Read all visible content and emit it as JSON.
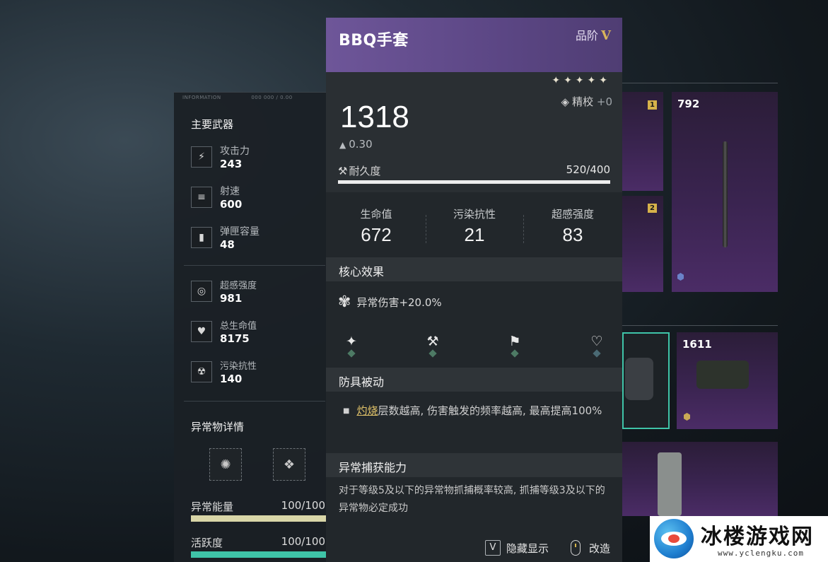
{
  "left_panel": {
    "header_small": [
      "INFORMATION",
      "000 000 / 0.00"
    ],
    "title": "主要武器",
    "weapon_stats": [
      {
        "icon": "attack-icon",
        "label": "攻击力",
        "value": "243"
      },
      {
        "icon": "fire-rate-icon",
        "label": "射速",
        "value": "600"
      },
      {
        "icon": "magazine-icon",
        "label": "弹匣容量",
        "value": "48"
      }
    ],
    "player_stats": [
      {
        "icon": "psi-intensity-icon",
        "label": "超感强度",
        "value": "981"
      },
      {
        "icon": "health-icon",
        "label": "总生命值",
        "value": "8175"
      },
      {
        "icon": "pollution-resist-icon",
        "label": "污染抗性",
        "value": "140"
      }
    ],
    "anomaly_title": "异常物详情",
    "bars": [
      {
        "label": "异常能量",
        "value": "100/100",
        "fraction": 1.0,
        "color": "#d9d6a8"
      },
      {
        "label": "活跃度",
        "value": "100/100",
        "fraction": 1.0,
        "color": "#3fc4a8"
      }
    ]
  },
  "item_card": {
    "name": "BBQ手套",
    "grade_label": "品阶",
    "grade_value": "V",
    "stars": "✦✦✦✦✦",
    "refine_label": "精校",
    "refine_value": "+0",
    "armor_value": "1318",
    "weight": "0.30",
    "durability_label": "耐久度",
    "durability_value": "520/400",
    "durability_fraction": 1.0,
    "stats": [
      {
        "label": "生命值",
        "value": "672"
      },
      {
        "label": "污染抗性",
        "value": "21"
      },
      {
        "label": "超感强度",
        "value": "83"
      }
    ],
    "core_effect_title": "核心效果",
    "core_effect_text": "异常伤害+20.0%",
    "passive_title": "防具被动",
    "passive_keyword": "灼烧",
    "passive_text": "层数越高, 伤害触发的频率越高, 最高提高100%",
    "capture_title": "异常捕获能力",
    "capture_text": "对于等级5及以下的异常物抓捕概率较高, 抓捕等级3及以下的异常物必定成功",
    "footer": {
      "hide_key": "V",
      "hide_label": "隐藏显示",
      "modify_label": "改造"
    }
  },
  "inventory": {
    "cards": [
      {
        "value": "792",
        "badge": "1"
      },
      {
        "value": "",
        "badge": "2"
      },
      {
        "value": "1611",
        "badge": ""
      }
    ]
  },
  "watermark": {
    "title": "冰楼游戏网",
    "url": "www.yclengku.com"
  }
}
